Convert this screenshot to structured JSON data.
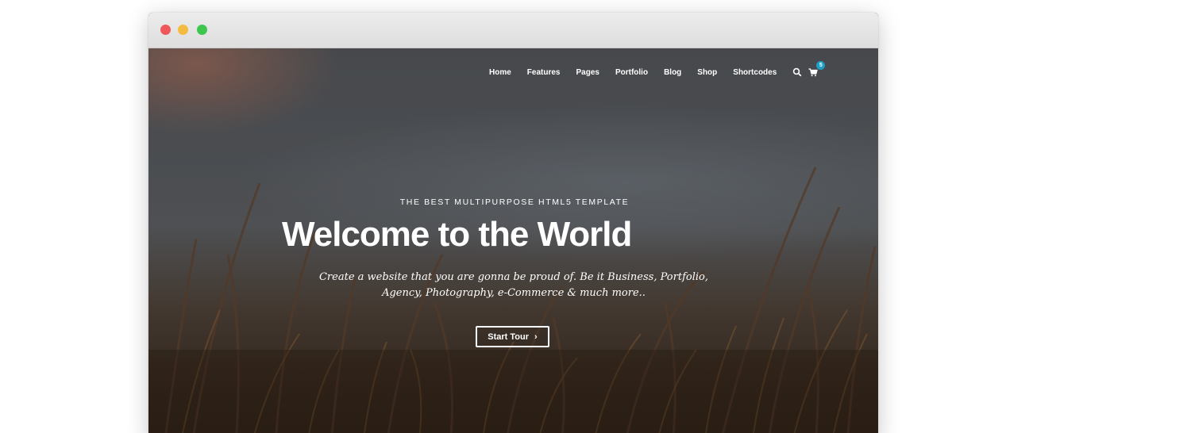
{
  "window": {
    "controls": [
      "close",
      "minimize",
      "maximize"
    ]
  },
  "nav": {
    "items": [
      "Home",
      "Features",
      "Pages",
      "Portfolio",
      "Blog",
      "Shop",
      "Shortcodes"
    ],
    "search_icon": "search-icon",
    "cart_icon": "cart-icon",
    "cart_count": "5"
  },
  "hero": {
    "kicker": "THE BEST MULTIPURPOSE HTML5 TEMPLATE",
    "title": "Welcome to the World",
    "subtitle_line1": "Create a website that you are gonna be proud of. Be it Business, Portfolio,",
    "subtitle_line2": "Agency, Photography, e-Commerce & much more..",
    "cta_label": "Start Tour",
    "cta_icon": "chevron-right-icon"
  },
  "colors": {
    "close": "#f0575a",
    "minimize": "#f5bb41",
    "maximize": "#3fc64e",
    "badge": "#1ea0c4"
  }
}
